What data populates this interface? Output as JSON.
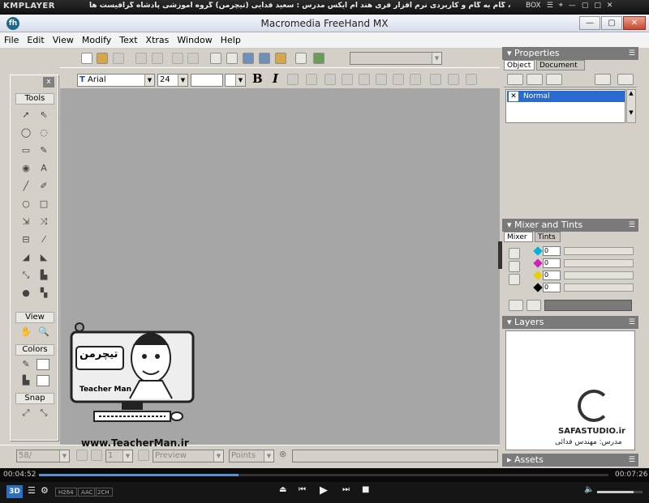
{
  "player": {
    "logo": "KMPLAYER",
    "title": "مجموعه آموزشی جامع ، گام به گام و کاربردی نرم افزار فری هند ام ایکس مدرس : سعید فدایی (تیچرمن) گروه آموزشی پادشاه گرافیست ها",
    "box_label": "BOX",
    "elapsed": "00:04:52",
    "total": "00:07:26",
    "tags": [
      "H264",
      "AAC",
      "2CH"
    ],
    "mode_label": "3D",
    "progress_fraction": 0.35,
    "volume_fraction": 0.8
  },
  "window": {
    "title": "Macromedia FreeHand MX",
    "app_icon": "fh"
  },
  "menu": [
    "File",
    "Edit",
    "View",
    "Modify",
    "Text",
    "Xtras",
    "Window",
    "Help"
  ],
  "text_toolbar": {
    "font_value": "Arial",
    "size_value": "24",
    "bold": "B",
    "italic": "I"
  },
  "tools": {
    "close": "x",
    "header": "Tools",
    "view_header": "View",
    "colors_header": "Colors",
    "snap_header": "Snap",
    "glyphs": [
      "➚",
      "⇖",
      "◯",
      "◌",
      "▭",
      "✎",
      "◉",
      "A",
      "╱",
      "✐",
      "○",
      "□",
      "⇲",
      "⤨",
      "⊟",
      "⁄",
      "◢",
      "◣",
      "⤡",
      "▙",
      "●",
      "▚"
    ],
    "view_glyphs": [
      "✋",
      "🔍"
    ],
    "color_glyphs": [
      "✎",
      "◧",
      "▙",
      "◧"
    ],
    "snap_glyphs": [
      "⤢",
      "⤡"
    ]
  },
  "properties": {
    "title": "Properties",
    "tabs": [
      "Object",
      "Document"
    ],
    "selected_item": "Normal"
  },
  "mixer": {
    "title": "Mixer and Tints",
    "tabs": [
      "Mixer",
      "Tints"
    ],
    "channels": [
      {
        "color": "#00b0d8",
        "value": "0"
      },
      {
        "color": "#d020c0",
        "value": "0"
      },
      {
        "color": "#e8d000",
        "value": "0"
      },
      {
        "color": "#000000",
        "value": "0"
      }
    ]
  },
  "layers": {
    "title": "Layers"
  },
  "assets": {
    "title": "Assets"
  },
  "status": {
    "zoom_value": "58/",
    "page_value": "1",
    "preview_value": "Preview",
    "units_value": "Points"
  },
  "watermark_left": {
    "logo_text": "تیچرمن",
    "name": "Teacher Man",
    "url": "www.TeacherMan.ir"
  },
  "watermark_right": {
    "brand": "SAFASTUDIO.ir",
    "caption": "مدرس: مهندس فدائی"
  }
}
